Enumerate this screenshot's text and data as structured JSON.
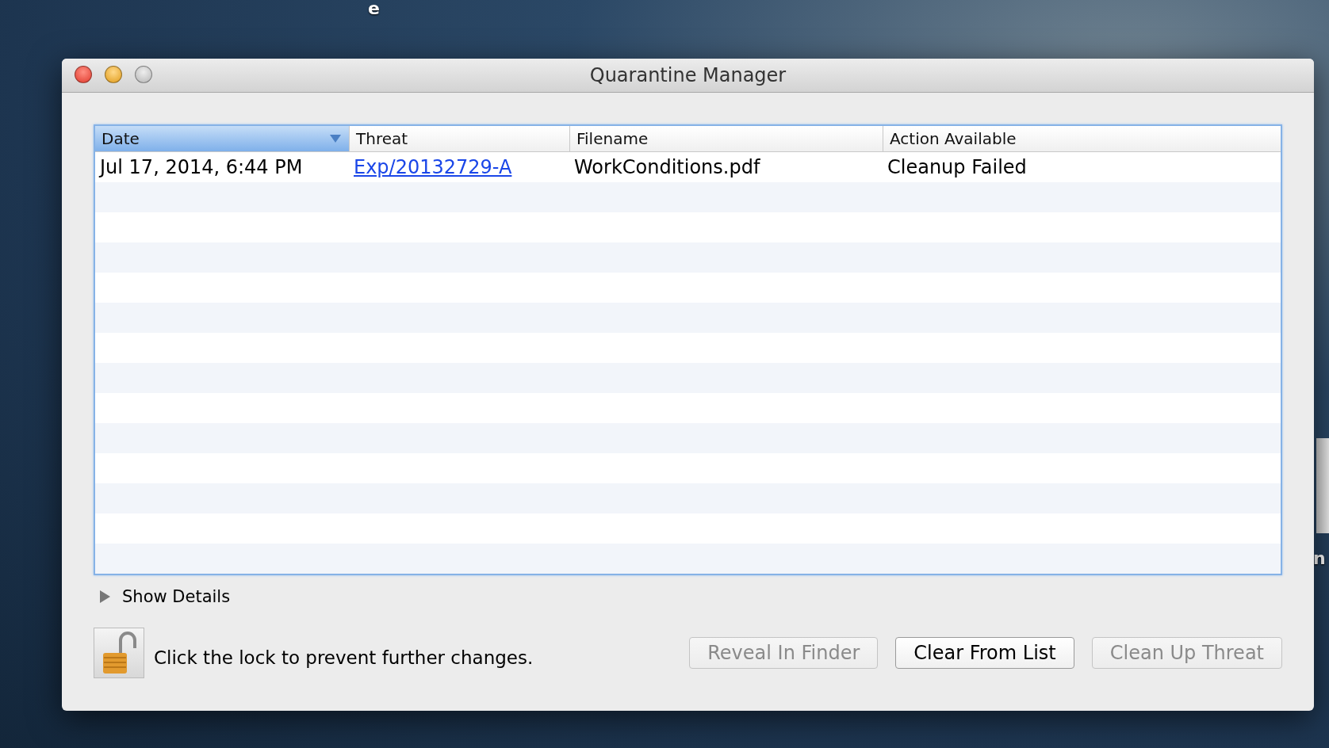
{
  "desktop": {
    "icon_labels": [
      "e",
      "n"
    ]
  },
  "window": {
    "title": "Quarantine Manager"
  },
  "table": {
    "columns": [
      {
        "label": "Date",
        "sorted": true
      },
      {
        "label": "Threat",
        "sorted": false
      },
      {
        "label": "Filename",
        "sorted": false
      },
      {
        "label": "Action Available",
        "sorted": false
      }
    ],
    "rows": [
      {
        "date": "Jul 17, 2014, 6:44 PM",
        "threat": "Exp/20132729-A",
        "filename": "WorkConditions.pdf",
        "action": "Cleanup Failed"
      }
    ]
  },
  "details": {
    "label": "Show Details",
    "expanded": false
  },
  "lock": {
    "message": "Click the lock to prevent further changes.",
    "locked": false
  },
  "buttons": [
    {
      "label": "Reveal In Finder",
      "disabled": true
    },
    {
      "label": "Clear From List",
      "disabled": false
    },
    {
      "label": "Clean Up Threat",
      "disabled": true
    }
  ]
}
